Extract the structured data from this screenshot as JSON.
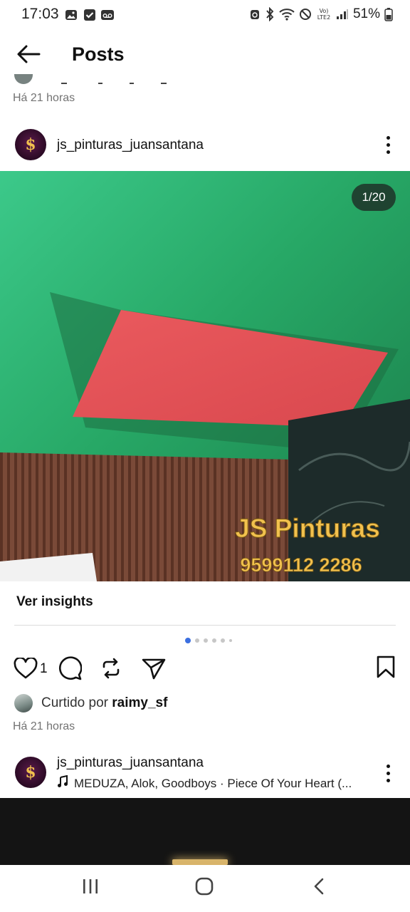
{
  "status_bar": {
    "time": "17:03",
    "battery": "51%",
    "network_badge": "VoLTE2"
  },
  "header": {
    "title": "Posts"
  },
  "previous_post": {
    "timestamp": "Há 21 horas"
  },
  "post": {
    "username": "js_pinturas_juansantana",
    "avatar_glyph": "$",
    "media_counter": "1/20",
    "overlay_brand": "JS Pinturas",
    "overlay_phone": "9599112 2286",
    "insights_label": "Ver insights",
    "carousel_dots": 6,
    "carousel_active_index": 0,
    "like_count": "1",
    "liked_by_prefix": "Curtido por",
    "liked_by_user": "raimy_sf",
    "timestamp": "Há 21 horas"
  },
  "next_post": {
    "username": "js_pinturas_juansantana",
    "avatar_glyph": "$",
    "music": "MEDUZA, Alok, Goodboys · Piece Of Your Heart (..."
  },
  "icons": {
    "back": "arrow-left-icon",
    "more": "more-vertical-icon",
    "like": "heart-icon",
    "comment": "comment-icon",
    "repost": "repost-icon",
    "share": "send-icon",
    "save": "bookmark-icon",
    "music": "music-note-icon",
    "nav_recents": "recents-icon",
    "nav_home": "home-icon",
    "nav_back": "nav-back-icon"
  },
  "colors": {
    "accent_dot": "#3b6fe0",
    "text_primary": "#111111",
    "text_secondary": "#737373",
    "overlay_text": "#f2c14e"
  }
}
